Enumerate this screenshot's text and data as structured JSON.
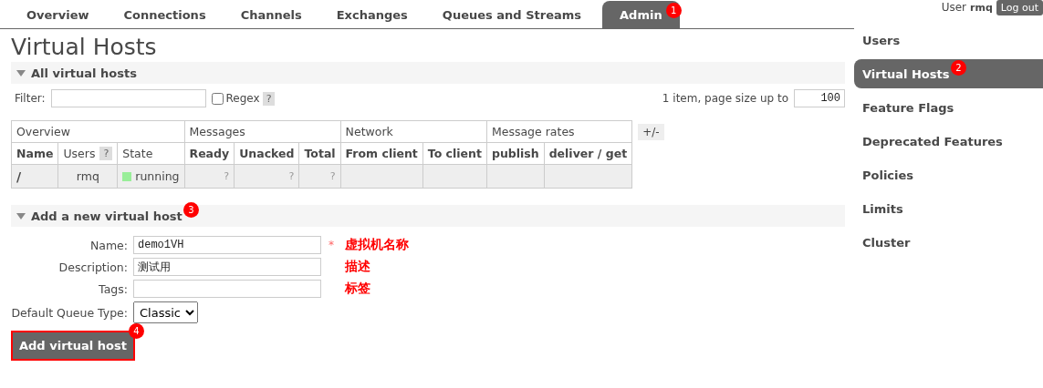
{
  "user": {
    "label": "User",
    "name": "rmq",
    "logout": "Log out"
  },
  "tabs": [
    {
      "label": "Overview",
      "selected": false
    },
    {
      "label": "Connections",
      "selected": false
    },
    {
      "label": "Channels",
      "selected": false
    },
    {
      "label": "Exchanges",
      "selected": false
    },
    {
      "label": "Queues and Streams",
      "selected": false
    },
    {
      "label": "Admin",
      "selected": true,
      "badge": "1"
    }
  ],
  "title": "Virtual Hosts",
  "list_section": {
    "title": "All virtual hosts",
    "expanded": true,
    "filter_label": "Filter:",
    "regex": {
      "label": "Regex",
      "checked": false,
      "help": "?"
    },
    "paging_text": "1 item, page size up to",
    "page_size": "100"
  },
  "table": {
    "toggle": "+/-",
    "groups": [
      {
        "label": "Overview",
        "columns": [
          {
            "label": "Name",
            "bold": true
          },
          {
            "label": "Users",
            "bold": false,
            "help": "?"
          },
          {
            "label": "State",
            "bold": false
          }
        ]
      },
      {
        "label": "Messages",
        "columns": [
          {
            "label": "Ready",
            "bold": true
          },
          {
            "label": "Unacked",
            "bold": true
          },
          {
            "label": "Total",
            "bold": true
          }
        ]
      },
      {
        "label": "Network",
        "columns": [
          {
            "label": "From client",
            "bold": true
          },
          {
            "label": "To client",
            "bold": true
          }
        ]
      },
      {
        "label": "Message rates",
        "columns": [
          {
            "label": "publish",
            "bold": true
          },
          {
            "label": "deliver / get",
            "bold": true
          }
        ]
      }
    ],
    "rows": [
      {
        "cells": [
          {
            "kind": "name",
            "text": "/"
          },
          {
            "kind": "center",
            "text": "rmq"
          },
          {
            "kind": "state",
            "text": "running",
            "color": "#99ee99"
          },
          {
            "kind": "help",
            "text": "?"
          },
          {
            "kind": "help",
            "text": "?"
          },
          {
            "kind": "help",
            "text": "?"
          },
          {
            "kind": "empty"
          },
          {
            "kind": "empty"
          },
          {
            "kind": "empty"
          },
          {
            "kind": "empty"
          }
        ]
      }
    ]
  },
  "add_section": {
    "title": "Add a new virtual host",
    "expanded": true,
    "badge": "3",
    "fields": [
      {
        "label": "Name:",
        "value": "demo1VH",
        "mono": true,
        "required_mark": "*",
        "note": "虚拟机名称"
      },
      {
        "label": "Description:",
        "value": "测试用",
        "note": "描述"
      },
      {
        "label": "Tags:",
        "note": "标签"
      }
    ],
    "queue_type": {
      "label": "Default Queue Type:",
      "value": "Classic"
    },
    "button": {
      "label": "Add virtual host",
      "badge": "4"
    }
  },
  "sidebar": {
    "items": [
      {
        "label": "Users",
        "selected": false
      },
      {
        "label": "Virtual Hosts",
        "selected": true,
        "badge": "2"
      },
      {
        "label": "Feature Flags",
        "selected": false
      },
      {
        "label": "Deprecated Features",
        "selected": false
      },
      {
        "label": "Policies",
        "selected": false
      },
      {
        "label": "Limits",
        "selected": false
      },
      {
        "label": "Cluster",
        "selected": false
      }
    ]
  }
}
